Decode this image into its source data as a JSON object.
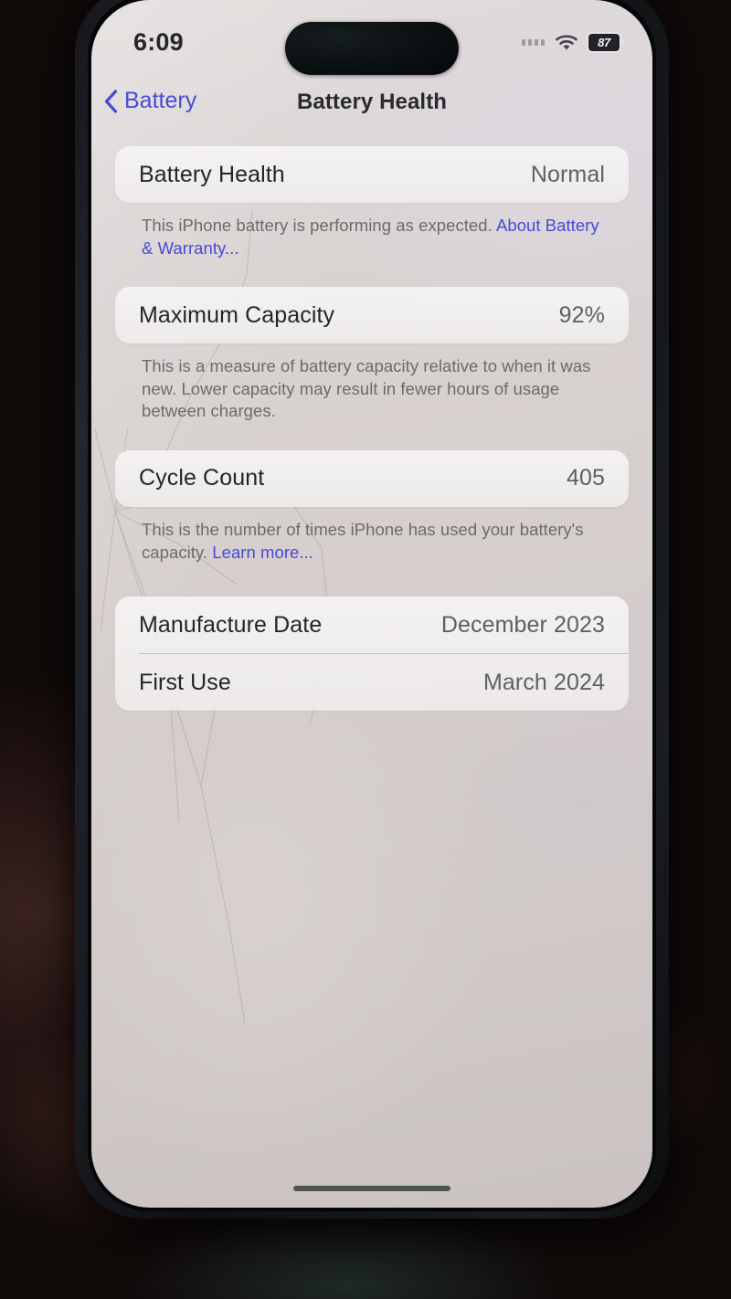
{
  "status_bar": {
    "time": "6:09",
    "signal_icon": "cellular-dots-icon",
    "wifi_icon": "wifi-icon",
    "battery_icon": "battery-icon",
    "battery_percent": "87"
  },
  "nav": {
    "back_label": "Battery",
    "back_icon": "chevron-left-icon",
    "title": "Battery Health"
  },
  "sections": {
    "health": {
      "label": "Battery Health",
      "value": "Normal",
      "footnote_text": "This iPhone battery is performing as expected. ",
      "footnote_link": "About Battery & Warranty..."
    },
    "capacity": {
      "label": "Maximum Capacity",
      "value": "92%",
      "footnote_text": "This is a measure of battery capacity relative to when it was new. Lower capacity may result in fewer hours of usage between charges."
    },
    "cycles": {
      "label": "Cycle Count",
      "value": "405",
      "footnote_text": "This is the number of times iPhone has used your battery's capacity. ",
      "footnote_link": "Learn more..."
    },
    "dates": {
      "manufacture_label": "Manufacture Date",
      "manufacture_value": "December 2023",
      "first_use_label": "First Use",
      "first_use_value": "March 2024"
    }
  },
  "home_indicator": "home-indicator",
  "colors": {
    "link_blue": "#4a49d8",
    "screen_bg": "#d4cdcb",
    "card_bg": "#f4f1f1"
  }
}
